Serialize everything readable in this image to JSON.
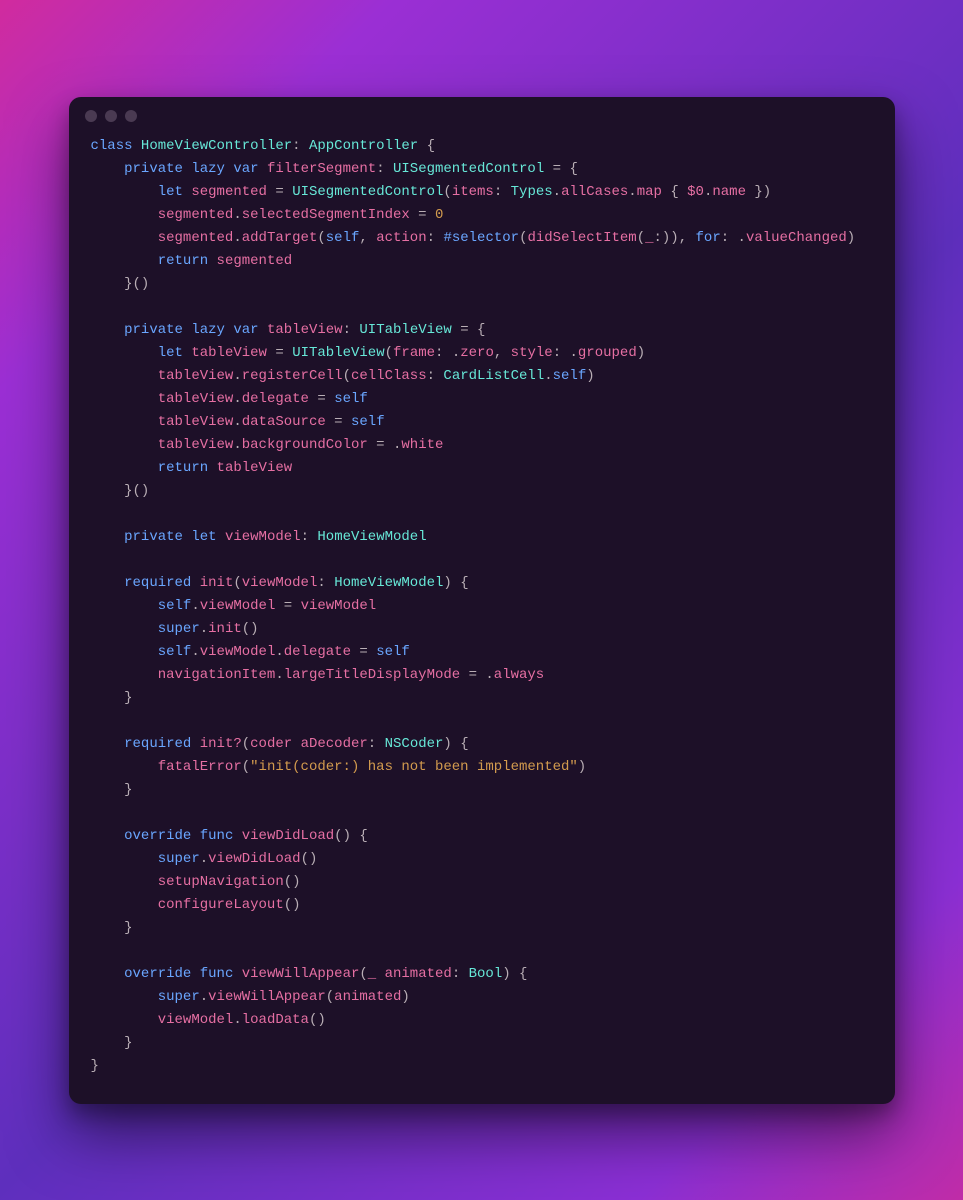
{
  "colors": {
    "background_gradient": [
      "#d12b9e",
      "#9b2fd4",
      "#5e2fbd",
      "#8b2fd4",
      "#c02ca7"
    ],
    "window_bg": "#1d1028",
    "dot": "#4a3a52",
    "text_default": "#b9aeb5",
    "keyword": "#6aa6ff",
    "type": "#67e8d8",
    "function": "#e66fa3",
    "literal": "#d39b4e"
  },
  "titlebar": {
    "dot_count": 3
  },
  "code": {
    "l1": {
      "kw1": "class",
      "t1": "HomeViewController",
      "p1": ": ",
      "t2": "AppController",
      "p2": " {"
    },
    "l2": {
      "i": "    ",
      "kw1": "private",
      "kw2": "lazy",
      "kw3": "var",
      "f1": "filterSegment",
      "p1": ": ",
      "t1": "UISegmentedControl",
      "p2": " = {"
    },
    "l3": {
      "i": "        ",
      "kw1": "let",
      "f1": "segmented",
      "p1": " = ",
      "t1": "UISegmentedControl",
      "p2": "(",
      "f2": "items",
      "p3": ": ",
      "t2": "Types",
      "p4": ".",
      "f3": "allCases",
      "p5": ".",
      "f4": "map",
      "p6": " { ",
      "f5": "$0",
      "p7": ".",
      "f6": "name",
      "p8": " })"
    },
    "l4": {
      "i": "        ",
      "f1": "segmented",
      "p1": ".",
      "f2": "selectedSegmentIndex",
      "p2": " = ",
      "n1": "0"
    },
    "l5": {
      "i": "        ",
      "f1": "segmented",
      "p1": ".",
      "f2": "addTarget",
      "p2": "(",
      "kw1": "self",
      "p3": ", ",
      "f3": "action",
      "p4": ": ",
      "kw2": "#selector",
      "p5": "(",
      "f4": "didSelectItem",
      "p6": "(",
      "f5": "_",
      "p7": ":)), ",
      "kw3": "for",
      "p8": ": "
    },
    "l5b": {
      "p1": ".",
      "f1": "valueChanged",
      "p2": ")"
    },
    "l6": {
      "i": "        ",
      "kw1": "return",
      "f1": "segmented"
    },
    "l7": {
      "i": "    ",
      "p1": "}()"
    },
    "l9": {
      "i": "    ",
      "kw1": "private",
      "kw2": "lazy",
      "kw3": "var",
      "f1": "tableView",
      "p1": ": ",
      "t1": "UITableView",
      "p2": " = {"
    },
    "l10": {
      "i": "        ",
      "kw1": "let",
      "f1": "tableView",
      "p1": " = ",
      "t1": "UITableView",
      "p2": "(",
      "f2": "frame",
      "p3": ": .",
      "f3": "zero",
      "p4": ", ",
      "f4": "style",
      "p5": ": .",
      "f5": "grouped",
      "p6": ")"
    },
    "l11": {
      "i": "        ",
      "f1": "tableView",
      "p1": ".",
      "f2": "registerCell",
      "p2": "(",
      "f3": "cellClass",
      "p3": ": ",
      "t1": "CardListCell",
      "p4": ".",
      "kw1": "self",
      "p5": ")"
    },
    "l12": {
      "i": "        ",
      "f1": "tableView",
      "p1": ".",
      "f2": "delegate",
      "p2": " = ",
      "kw1": "self"
    },
    "l13": {
      "i": "        ",
      "f1": "tableView",
      "p1": ".",
      "f2": "dataSource",
      "p2": " = ",
      "kw1": "self"
    },
    "l14": {
      "i": "        ",
      "f1": "tableView",
      "p1": ".",
      "f2": "backgroundColor",
      "p2": " = .",
      "f3": "white"
    },
    "l15": {
      "i": "        ",
      "kw1": "return",
      "f1": "tableView"
    },
    "l16": {
      "i": "    ",
      "p1": "}()"
    },
    "l18": {
      "i": "    ",
      "kw1": "private",
      "kw2": "let",
      "f1": "viewModel",
      "p1": ": ",
      "t1": "HomeViewModel"
    },
    "l20": {
      "i": "    ",
      "kw1": "required",
      "f1": "init",
      "p1": "(",
      "f2": "viewModel",
      "p2": ": ",
      "t1": "HomeViewModel",
      "p3": ") {"
    },
    "l21": {
      "i": "        ",
      "kw1": "self",
      "p1": ".",
      "f1": "viewModel",
      "p2": " = ",
      "f2": "viewModel"
    },
    "l22": {
      "i": "        ",
      "kw1": "super",
      "p1": ".",
      "f1": "init",
      "p2": "()"
    },
    "l23": {
      "i": "        ",
      "kw1": "self",
      "p1": ".",
      "f1": "viewModel",
      "p2": ".",
      "f2": "delegate",
      "p3": " = ",
      "kw2": "self"
    },
    "l24": {
      "i": "        ",
      "f1": "navigationItem",
      "p1": ".",
      "f2": "largeTitleDisplayMode",
      "p2": " = .",
      "f3": "always"
    },
    "l25": {
      "i": "    ",
      "p1": "}"
    },
    "l27": {
      "i": "    ",
      "kw1": "required",
      "f1": "init",
      "op1": "?",
      "p1": "(",
      "f2": "coder",
      "f3": "aDecoder",
      "p2": ": ",
      "t1": "NSCoder",
      "p3": ") {"
    },
    "l28": {
      "i": "        ",
      "f1": "fatalError",
      "p1": "(",
      "s1": "\"init(coder:) has not been implemented\"",
      "p2": ")"
    },
    "l29": {
      "i": "    ",
      "p1": "}"
    },
    "l31": {
      "i": "    ",
      "kw1": "override",
      "kw2": "func",
      "f1": "viewDidLoad",
      "p1": "() {"
    },
    "l32": {
      "i": "        ",
      "kw1": "super",
      "p1": ".",
      "f1": "viewDidLoad",
      "p2": "()"
    },
    "l33": {
      "i": "        ",
      "f1": "setupNavigation",
      "p1": "()"
    },
    "l34": {
      "i": "        ",
      "f1": "configureLayout",
      "p1": "()"
    },
    "l35": {
      "i": "    ",
      "p1": "}"
    },
    "l37": {
      "i": "    ",
      "kw1": "override",
      "kw2": "func",
      "f1": "viewWillAppear",
      "p1": "(",
      "f2": "_",
      "f3": "animated",
      "p2": ": ",
      "t1": "Bool",
      "p3": ") {"
    },
    "l38": {
      "i": "        ",
      "kw1": "super",
      "p1": ".",
      "f1": "viewWillAppear",
      "p2": "(",
      "f2": "animated",
      "p3": ")"
    },
    "l39": {
      "i": "        ",
      "f1": "viewModel",
      "p1": ".",
      "f2": "loadData",
      "p2": "()"
    },
    "l40": {
      "i": "    ",
      "p1": "}"
    },
    "l41": {
      "p1": "}"
    }
  }
}
